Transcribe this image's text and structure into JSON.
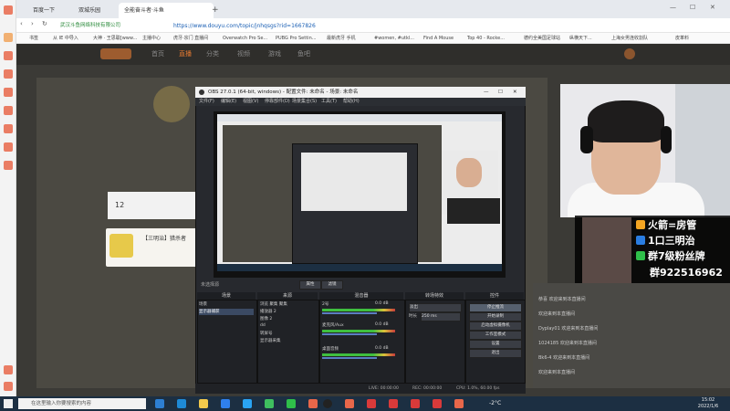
{
  "browser": {
    "tabs": [
      {
        "title": "百度一下",
        "active": false
      },
      {
        "title": "双城乐园",
        "active": false
      },
      {
        "title": "全能奋斗者·斗鱼",
        "active": true
      }
    ],
    "new_tab": "+",
    "url": "https://www.douyu.com/topic/jnhqsgs?rid=1667826",
    "site_badge": "武汉斗鱼网络科技有限公司",
    "bookmarks": [
      "书签",
      "从 IE 中导入",
      "大神 · 王思聪[www...",
      "主播中心",
      "虎牙·宗门 直播间",
      "Overwatch Pro Se...",
      "PUBG Pro Settin...",
      "最新虎牙 手机",
      "#women, #utkl...",
      "Find A Mouse",
      "Top 40 - Rocke...",
      "德约全美国足球站",
      "纵横天下...",
      "上海女男连收割队",
      "皮革料"
    ]
  },
  "douyu": {
    "nav": [
      {
        "label": "首页",
        "active": false
      },
      {
        "label": "直播",
        "active": true
      },
      {
        "label": "分类",
        "active": false
      },
      {
        "label": "视频",
        "active": false
      },
      {
        "label": "游戏",
        "active": false
      },
      {
        "label": "鱼吧",
        "active": false
      }
    ],
    "card_title": "【三明治】猎杀者",
    "card_badge": "12"
  },
  "obs": {
    "title": "OBS 27.0.1 (64-bit, windows) - 配置文件: 未命名 - 场景: 未命名",
    "menu": [
      "文件(F)",
      "编辑(E)",
      "视图(V)",
      "停靠部件(D)",
      "场景集合(S)",
      "工具(T)",
      "帮助(H)"
    ],
    "source_label": "未选择源",
    "props_label": "属性",
    "filter_label": "滤镜",
    "docks": {
      "scenes": "场景",
      "sources": "来源",
      "mixer": "混音器",
      "transitions": "转场特效",
      "controls": "控件"
    },
    "scenes": [
      "场景",
      "显示器捕获"
    ],
    "sources": [
      "浏览 聚集 聚集",
      "播放器 2",
      "图像 2",
      "dd",
      "转屏号",
      "显示器采集"
    ],
    "mixer": [
      {
        "name": "2号",
        "db": "0.0 dB"
      },
      {
        "name": "麦克风/Aux",
        "db": "0.0 dB"
      },
      {
        "name": "桌面音频",
        "db": "0.0 dB"
      }
    ],
    "transition": {
      "type": "淡出",
      "duration_label": "时长",
      "duration": "250 ms"
    },
    "controls": [
      "停止推流",
      "开始录制",
      "启动虚拟摄像机",
      "工作室模式",
      "设置",
      "退出"
    ],
    "status": {
      "live": "LIVE: 00:00:00",
      "rec": "REC: 00:00:00",
      "cpu": "CPU: 1.0%, 60.00 fps"
    }
  },
  "overlay": {
    "lines": [
      {
        "text": "火箭=房管",
        "color": "#f5a623"
      },
      {
        "text": "1口三明治",
        "color": "#2a7de1"
      },
      {
        "text": "群7级粉丝牌",
        "color": "#2fbf4a"
      },
      {
        "text": "群922516962",
        "color": ""
      }
    ]
  },
  "chat": [
    "恭喜 欢迎来到本直播间",
    "欢迎来到本直播间",
    "Dyplay01 欢迎来到本直播间",
    "1024185 欢迎来到本直播间",
    "Bk6-4 欢迎来到本直播间",
    "欢迎来到本直播间"
  ],
  "taskbar": {
    "search_placeholder": "在这里输入你要搜索的内容",
    "weather": "-2°C",
    "time": "15:02",
    "date": "2022/1/6"
  }
}
